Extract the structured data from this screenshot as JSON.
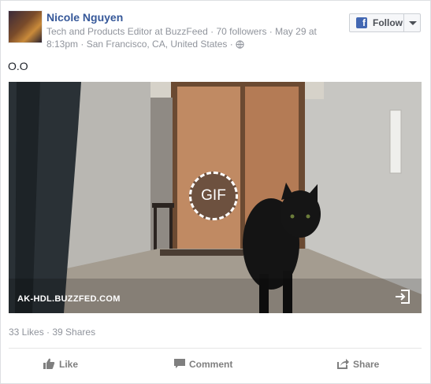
{
  "post": {
    "author": "Nicole Nguyen",
    "meta_line1": "Tech and Products Editor at BuzzFeed · 70 followers · May 29 at",
    "meta_line2": "8:13pm · San Francisco, CA, United States ·",
    "follow_label": "Follow",
    "text": "O.O"
  },
  "media": {
    "badge": "GIF",
    "domain": "AK-HDL.BUZZFED.COM"
  },
  "stats": {
    "text": "33 Likes · 39 Shares"
  },
  "actions": {
    "like": "Like",
    "comment": "Comment",
    "share": "Share"
  },
  "icons": [
    "globe-icon",
    "facebook-icon",
    "chevron-down-icon",
    "expand-icon",
    "like-icon",
    "comment-icon",
    "share-icon"
  ],
  "colors": {
    "name_link": "#365899",
    "meta_text": "#90949c",
    "facebook_blue": "#4267b2",
    "action_text": "#7f7f7f"
  }
}
